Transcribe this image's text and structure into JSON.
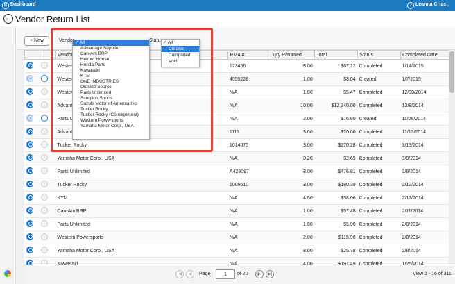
{
  "topbar": {
    "dashboard_label": "Dashboard",
    "user_name": "Leanna Criss",
    "caret": "⌄",
    "help": "?"
  },
  "page": {
    "title": "Vendor Return List",
    "back": "←"
  },
  "toolbar": {
    "new_label": "+ New",
    "vendor_label": "Vendor",
    "status_label": "Status"
  },
  "columns": [
    "Vendor",
    "RMA #",
    "Qty Returned",
    "Total",
    "Status",
    "Completed Date"
  ],
  "rows": [
    {
      "vendor": "Western Powersports",
      "rma": "123456",
      "qty": "8.00",
      "total": "$67.12",
      "status": "Completed",
      "date": "1/14/2015"
    },
    {
      "vendor": "Western Powersports",
      "rma": "4555228",
      "qty": "1.00",
      "total": "$3.04",
      "status": "Created",
      "date": "1/7/2015"
    },
    {
      "vendor": "Western Powersports",
      "rma": "N/A",
      "qty": "1.00",
      "total": "$5.47",
      "status": "Completed",
      "date": "12/30/2014"
    },
    {
      "vendor": "Advantage Supplier",
      "rma": "N/A",
      "qty": "10.00",
      "total": "$12,340.00",
      "status": "Completed",
      "date": "12/8/2014"
    },
    {
      "vendor": "Parts Unlimited",
      "rma": "N/A",
      "qty": "2.00",
      "total": "$16.80",
      "status": "Created",
      "date": "11/28/2014"
    },
    {
      "vendor": "Advantage Supplier",
      "rma": "1111",
      "qty": "3.00",
      "total": "$20.00",
      "status": "Completed",
      "date": "11/12/2014"
    },
    {
      "vendor": "Tucker Rocky",
      "rma": "1014075",
      "qty": "3.00",
      "total": "$270.28",
      "status": "Completed",
      "date": "3/13/2014"
    },
    {
      "vendor": "Yamaha Motor Corp., USA",
      "rma": "N/A",
      "qty": "0.20",
      "total": "$2.69",
      "status": "Completed",
      "date": "3/8/2014"
    },
    {
      "vendor": "Parts Unlimited",
      "rma": "A423097",
      "qty": "8.00",
      "total": "$476.81",
      "status": "Completed",
      "date": "3/8/2014"
    },
    {
      "vendor": "Tucker Rocky",
      "rma": "1009610",
      "qty": "3.00",
      "total": "$180.39",
      "status": "Completed",
      "date": "2/12/2014"
    },
    {
      "vendor": "KTM",
      "rma": "N/A",
      "qty": "4.00",
      "total": "$38.06",
      "status": "Completed",
      "date": "2/12/2014"
    },
    {
      "vendor": "Can-Am BRP",
      "rma": "N/A",
      "qty": "1.00",
      "total": "$57.48",
      "status": "Completed",
      "date": "2/11/2014"
    },
    {
      "vendor": "Parts Unlimited",
      "rma": "N/A",
      "qty": "1.00",
      "total": "$5.90",
      "status": "Completed",
      "date": "2/8/2014"
    },
    {
      "vendor": "Western Powersports",
      "rma": "N/A",
      "qty": "2.00",
      "total": "$115.98",
      "status": "Completed",
      "date": "2/8/2014"
    },
    {
      "vendor": "Yamaha Motor Corp., USA",
      "rma": "N/A",
      "qty": "8.00",
      "total": "$25.78",
      "status": "Completed",
      "date": "2/8/2014"
    },
    {
      "vendor": "Kawasaki",
      "rma": "N/A",
      "qty": "4.00",
      "total": "$191.49",
      "status": "Completed",
      "date": "1/25/2014"
    }
  ],
  "vendor_options": [
    "✓ All",
    "Advantage Supplier",
    "Can-Am BRP",
    "Helmet House",
    "Honda Parts",
    "Kawasaki",
    "KTM",
    "ONE INDUSTRIES",
    "Outside Source",
    "Parts Unlimited",
    "Scorpion Sports",
    "Suzuki Motor of America Inc.",
    "Tucker Rocky",
    "Tucker Rocky (Consignment)",
    "Western Powersports",
    "Yamaha Motor Corp., USA"
  ],
  "status_options": [
    "✓ All",
    "Created",
    "Completed",
    "Void"
  ],
  "pager": {
    "page_label": "Page",
    "page_value": "1",
    "of_label": "of 20",
    "view_label": "View 1 - 16 of 311",
    "first": "|◀",
    "prev": "◀",
    "next": "▶",
    "last": "▶|"
  },
  "colors": {
    "topbar": "#1e7ac0",
    "highlight": "#e0402e",
    "accent": "#2a7ddb"
  }
}
